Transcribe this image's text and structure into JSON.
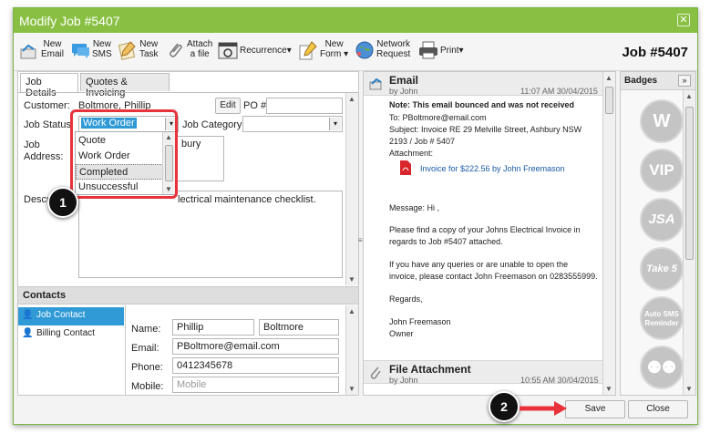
{
  "window": {
    "title": "Modify Job #5407",
    "close_glyph": "✕"
  },
  "toolbar": {
    "items": [
      {
        "line1": "New",
        "line2": "Email",
        "icon": "new-email-icon"
      },
      {
        "line1": "New",
        "line2": "SMS",
        "icon": "new-sms-icon"
      },
      {
        "line1": "New",
        "line2": "Task",
        "icon": "new-task-icon"
      },
      {
        "line1": "Attach",
        "line2": "a file",
        "icon": "paperclip-icon"
      },
      {
        "label": "Recurrence▾",
        "icon": "recurrence-icon"
      },
      {
        "line1": "New",
        "line2": "Form ▾",
        "icon": "new-form-icon"
      },
      {
        "line1": "Network",
        "line2": "Request",
        "icon": "network-icon"
      },
      {
        "label": "Print▾",
        "icon": "print-icon"
      }
    ],
    "job_number": "Job #5407"
  },
  "tabs": [
    "Job Details",
    "Quotes & Invoicing"
  ],
  "job": {
    "customer_label": "Customer:",
    "customer_value": "Boltmore, Phillip",
    "edit_label": "Edit",
    "po_label": "PO #",
    "po_value": "",
    "status_label": "Job Status:",
    "status_value": "Work Order",
    "category_label": "Job Category",
    "category_value": "",
    "address_label_1": "Job",
    "address_label_2": "Address:",
    "address_partial": "bury",
    "description_label": "Descri",
    "description_partial": "lectrical maintenance checklist."
  },
  "dropdown": {
    "options": [
      "Quote",
      "Work Order",
      "Completed",
      "Unsuccessful"
    ],
    "highlighted": "Completed"
  },
  "contacts": {
    "header": "Contacts",
    "items": [
      "Job Contact",
      "Billing Contact"
    ],
    "name_label": "Name:",
    "first_name": "Phillip",
    "last_name": "Boltmore",
    "email_label": "Email:",
    "email_value": "PBoltmore@email.com",
    "phone_label": "Phone:",
    "phone_value": "0412345678",
    "mobile_label": "Mobile:",
    "mobile_placeholder": "Mobile"
  },
  "email": {
    "title": "Email",
    "by": "by John",
    "time": "11:07 AM 30/04/2015",
    "note": "Note: This email bounced and was not received",
    "to": "To: PBoltmore@email.com",
    "subject1": "Subject: Invoice RE 29 Melville Street, Ashbury NSW",
    "subject2": "2193 / Job # 5407",
    "attachment_label": "Attachment:",
    "attachment_link": "Invoice for $222.56 by John Freemason",
    "msg_hi": "Message: Hi ,",
    "msg1": "Please find a copy of your Johns Electrical Invoice in",
    "msg2": "regards to Job #5407 attached.",
    "msg3": "If you have any queries or are unable to open the",
    "msg4": "invoice, please contact John Freemason on 0283555999.",
    "regards": "Regards,",
    "sig_name": "John Freemason",
    "sig_role": "Owner"
  },
  "file_attachment": {
    "title": "File Attachment",
    "by": "by John",
    "time": "10:55 AM 30/04/2015"
  },
  "badges": {
    "title": "Badges",
    "expand": "»",
    "items": [
      "W",
      "VIP",
      "JSA",
      "Take 5",
      "Auto SMS Reminder",
      ""
    ]
  },
  "footer": {
    "save": "Save",
    "close": "Close"
  },
  "callouts": [
    "1",
    "2"
  ],
  "colors": {
    "titlebar": "#89c043",
    "selected": "#2f9ad6",
    "highlight_box": "#e8333a",
    "link": "#1a5aa8"
  }
}
